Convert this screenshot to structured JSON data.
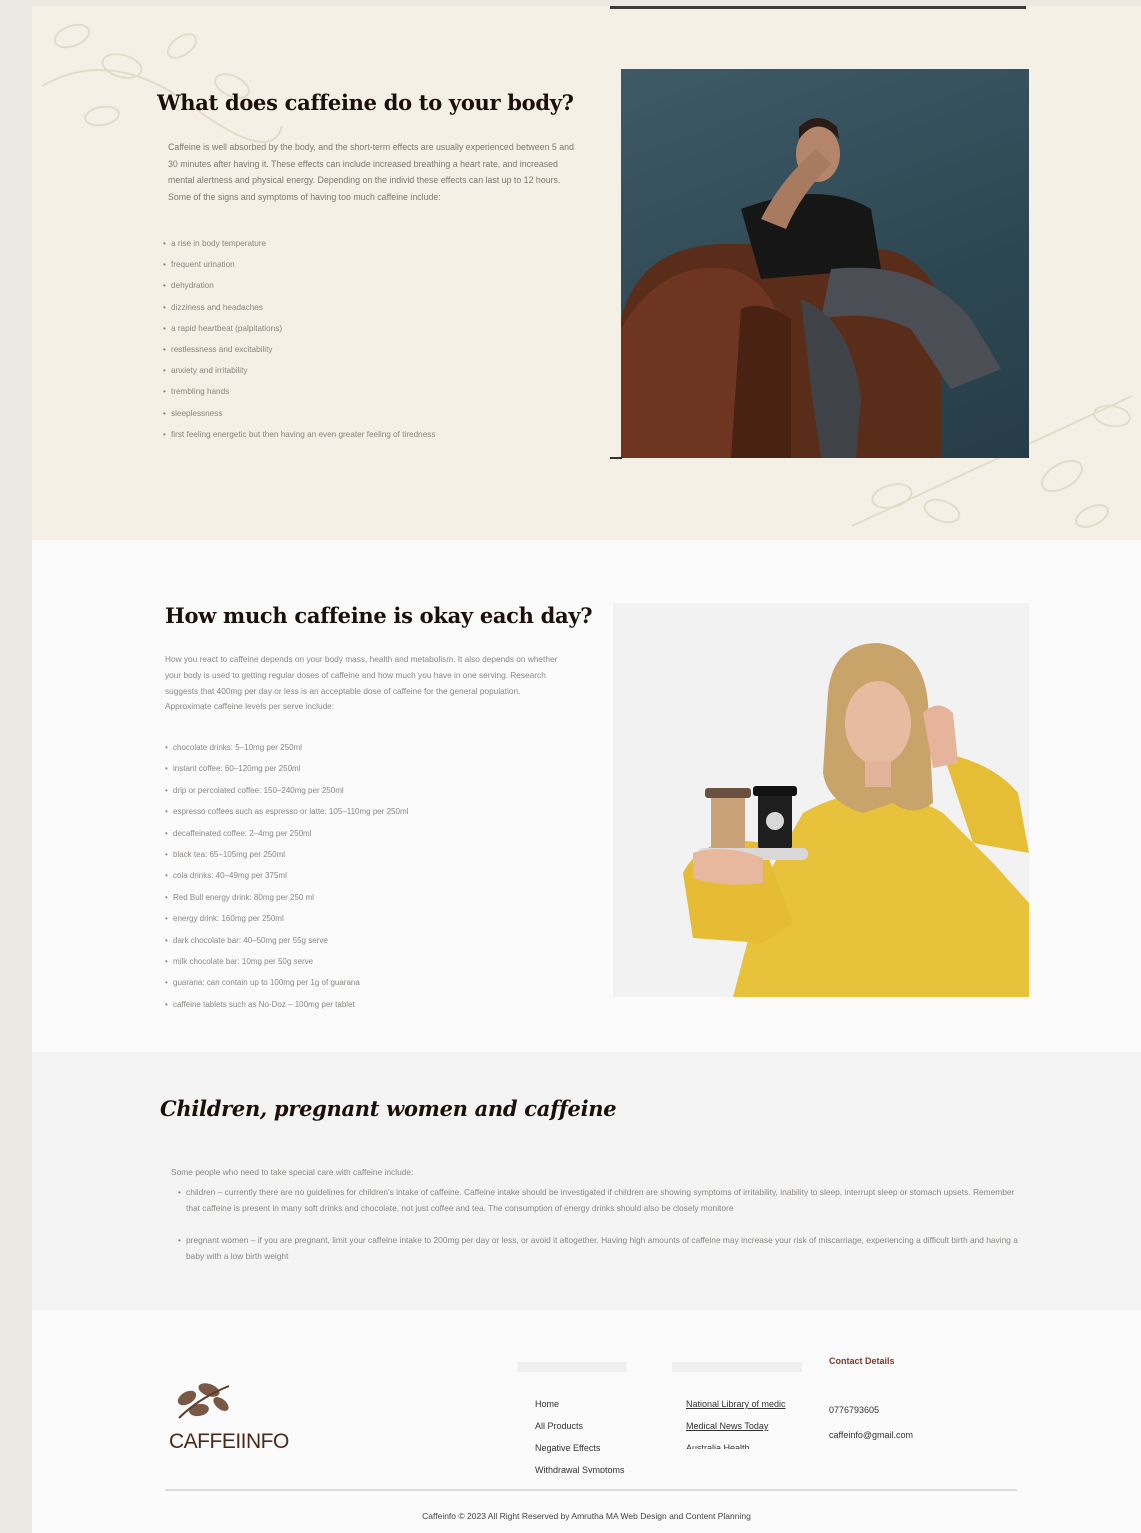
{
  "section1": {
    "title": "What does caffeine do to your body?",
    "paragraph": "Caffeine is well absorbed by the body, and the short-term effects are usually experienced between 5 and 30 minutes after having it. These effects can include increased breathing a heart rate, and increased mental alertness and physical energy. Depending on the individ these effects can last up to 12 hours.",
    "intro": "Some of the signs and symptoms of having too much caffeine include:",
    "items": [
      "a rise in body temperature",
      "frequent urination",
      "dehydration",
      "dizziness and headaches",
      "a rapid heartbeat (palpitations)",
      "restlessness and excitability",
      "anxiety and irritability",
      "trembling hands",
      "sleeplessness",
      "first feeling energetic but then having an even greater feeling of tiredness"
    ]
  },
  "section2": {
    "title": "How much caffeine is okay each day?",
    "paragraph": "How you react to caffeine depends on your body mass, health and metabolism. It also depends on whether your body is used to getting regular doses of caffeine and how much you have in one serving. Research suggests that 400mg per day or less is an acceptable dose of caffeine for the general population.",
    "intro": "Approximate caffeine levels per serve include:",
    "items": [
      "chocolate drinks: 5–10mg per 250ml",
      "instant coffee: 60–120mg per 250ml",
      "drip or percolated coffee: 150–240mg per 250ml",
      "espresso coffees such as espresso or latte: 105–110mg per 250ml",
      "decaffeinated coffee: 2–4mg per 250ml",
      "black tea: 65–105mg per 250ml",
      "cola drinks: 40–49mg per 375ml",
      "Red Bull energy drink: 80mg per 250 ml",
      "energy drink: 160mg per 250ml",
      "dark chocolate bar: 40–50mg per 55g serve",
      "milk chocolate bar: 10mg per 50g serve",
      "guarana: can contain up to 100mg per 1g of guarana",
      "caffeine tablets such as No-Doz – 100mg per tablet"
    ]
  },
  "section3": {
    "title": "Children, pregnant women and caffeine",
    "intro": "Some people who need to take special care with caffeine include:",
    "items": [
      "children – currently there are no guidelines for children's intake of caffeine. Caffeine intake should be investigated if children are showing symptoms of irritability, inability to sleep, interrupt sleep or stomach upsets. Remember that caffeine is present in many soft drinks and chocolate, not just coffee and tea. The consumption of energy drinks should also be closely monitore",
      "pregnant women – if you are pregnant, limit your caffeine intake to 200mg per day or less, or avoid it altogether. Having high amounts of caffeine may increase your risk of miscarriage, experiencing a difficult birth and having a baby with a low birth weight"
    ]
  },
  "footer": {
    "logo_text": "CAFFEIINFO",
    "links": [
      "Home",
      "All Products",
      "Negative Effects",
      "Withdrawal Symptoms"
    ],
    "external_links": [
      "National Library of medic",
      "Medical News Today",
      "Australia Health"
    ],
    "contact_title": "Contact Details",
    "phone": "0776793605",
    "email": "caffeinfo@gmail.com",
    "copyright": "Caffeinfo © 2023 All Right Reserved by Amrutha MA Web Design and Content Planning"
  },
  "colors": {
    "heading": "#1c0f0a",
    "beige_bg": "#f4f0e5",
    "accent": "#7a3a2a"
  }
}
